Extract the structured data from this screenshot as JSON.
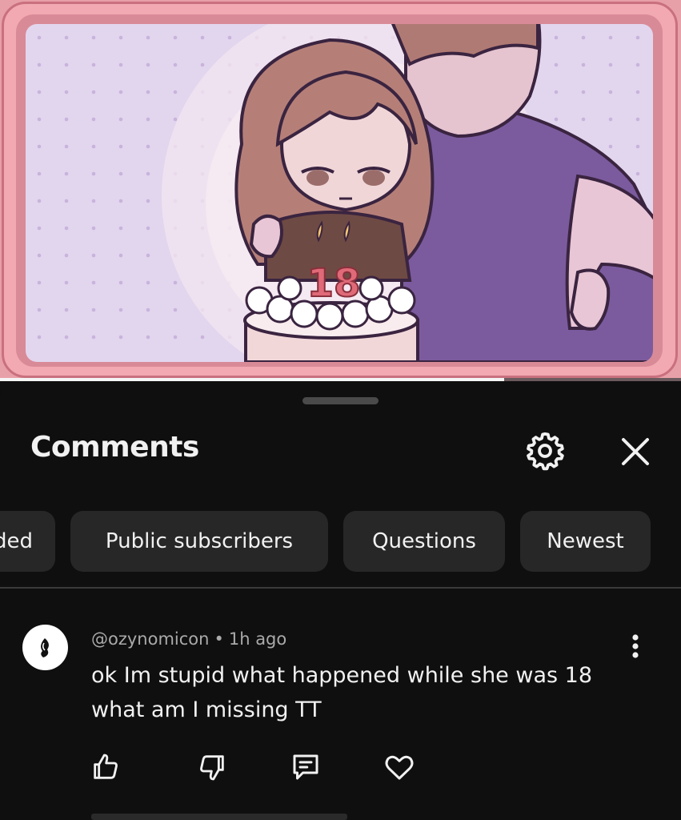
{
  "video": {
    "candle_number": "18",
    "progress_fraction": 0.74
  },
  "comments_panel": {
    "title": "Comments",
    "settings_icon": "gear-icon",
    "close_icon": "close-icon"
  },
  "filters": [
    {
      "label": "ded"
    },
    {
      "label": "Public subscribers"
    },
    {
      "label": "Questions"
    },
    {
      "label": "Newest"
    }
  ],
  "comment": {
    "author": "@ozynomicon",
    "separator": "•",
    "time": "1h ago",
    "text": "ok Im stupid what happened while she was 18 what am I missing TT"
  },
  "colors": {
    "background": "#0f0f0f",
    "chip": "#272727",
    "text": "#f1f1f1",
    "muted": "#aaaaaa"
  }
}
